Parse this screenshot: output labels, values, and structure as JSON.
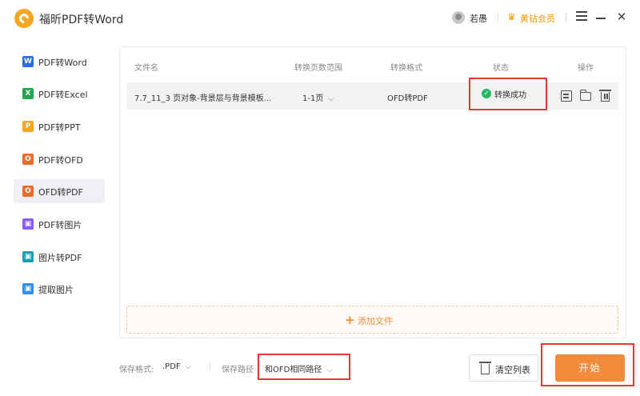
{
  "app": {
    "title": "福昕PDF转Word"
  },
  "titlebar": {
    "user_name": "若愚",
    "vip_label": "黄钻会员",
    "vip_icon": "crown-icon"
  },
  "colors": {
    "accent": "#f28c3c",
    "highlight_border": "#e53935",
    "success": "#29b765",
    "vip": "#f39800"
  },
  "sidebar": {
    "items": [
      {
        "label": "PDF转Word",
        "icon": "W",
        "color": "#2b6de5",
        "active": false
      },
      {
        "label": "PDF转Excel",
        "icon": "X",
        "color": "#22a64e",
        "active": false
      },
      {
        "label": "PDF转PPT",
        "icon": "P",
        "color": "#f5a623",
        "active": false
      },
      {
        "label": "PDF转OFD",
        "icon": "O",
        "color": "#ee6a2c",
        "active": false
      },
      {
        "label": "OFD转PDF",
        "icon": "O",
        "color": "#ee6a2c",
        "active": true
      },
      {
        "label": "PDF转图片",
        "icon": "▣",
        "color": "#8b5cf6",
        "active": false
      },
      {
        "label": "图片转PDF",
        "icon": "▣",
        "color": "#17a2b8",
        "active": false
      },
      {
        "label": "提取图片",
        "icon": "▣",
        "color": "#2f8ff0",
        "active": false
      }
    ]
  },
  "table": {
    "headers": {
      "filename": "文件名",
      "page_range": "转换页数范围",
      "format": "转换格式",
      "status": "状态",
      "actions": "操作"
    },
    "rows": [
      {
        "filename": "7.7_11_3 页对象-背景层与背景模板...",
        "page_range": "1-1页",
        "format": "OFD转PDF",
        "status": "转换成功"
      }
    ]
  },
  "add_files": {
    "label": "添加文件",
    "plus": "+"
  },
  "footer": {
    "save_format_label": "保存格式:",
    "save_format_value": ".PDF",
    "save_path_label": "保存路径",
    "save_path_value": "和OFD相同路径",
    "clear_label": "清空列表",
    "start_label": "开始"
  }
}
